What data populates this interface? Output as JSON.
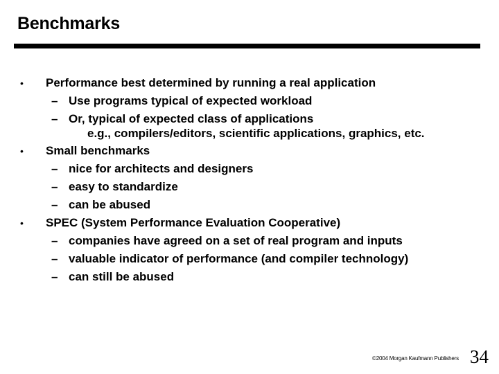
{
  "slide": {
    "title": "Benchmarks",
    "bullets": [
      {
        "text": "Performance best determined by running a real application",
        "subitems": [
          "Use programs typical of expected workload",
          "Or, typical of expected class of applications"
        ],
        "continuation": "e.g., compilers/editors, scientific applications, graphics, etc."
      },
      {
        "text": "Small benchmarks",
        "subitems": [
          "nice for architects and designers",
          "easy to standardize",
          "can be abused"
        ]
      },
      {
        "text": "SPEC (System Performance Evaluation Cooperative)",
        "subitems": [
          "companies have agreed on a set of real program and inputs",
          "valuable indicator of  performance (and compiler technology)",
          "can still be abused"
        ]
      }
    ],
    "bullet_glyph": "•",
    "dash_glyph": "–",
    "footer": "©2004 Morgan Kaufmann Publishers",
    "page_number": "34"
  }
}
